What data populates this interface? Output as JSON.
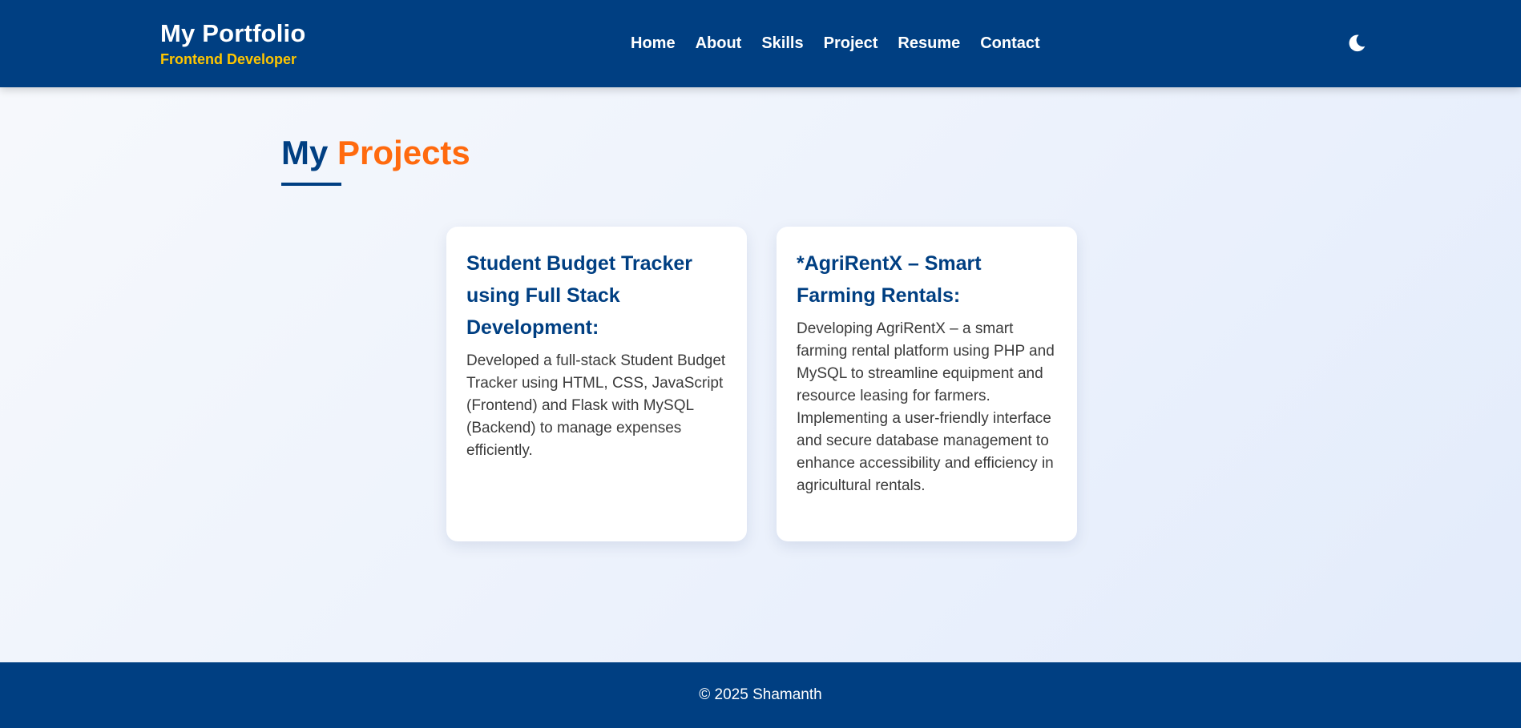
{
  "header": {
    "brand_title": "My Portfolio",
    "brand_subtitle": "Frontend Developer",
    "nav": [
      "Home",
      "About",
      "Skills",
      "Project",
      "Resume",
      "Contact"
    ],
    "theme_icon": "moon-icon"
  },
  "section": {
    "title_prefix": "My",
    "title_accent": "Projects"
  },
  "projects": [
    {
      "title": "Student Budget Tracker using Full Stack Development:",
      "description": "Developed a full-stack Student Budget Tracker using HTML, CSS, JavaScript (Frontend) and Flask with MySQL (Backend) to manage expenses efficiently."
    },
    {
      "title": "*AgriRentX – Smart Farming Rentals:",
      "description": "Developing AgriRentX – a smart farming rental platform using PHP and MySQL to streamline equipment and resource leasing for farmers. Implementing a user-friendly interface and secure database management to enhance accessibility and efficiency in agricultural rentals."
    }
  ],
  "footer": {
    "copyright": "© 2025 Shamanth"
  },
  "colors": {
    "primary": "#003f82",
    "accent": "#ff6a0e",
    "subtitle": "#ffc600"
  }
}
